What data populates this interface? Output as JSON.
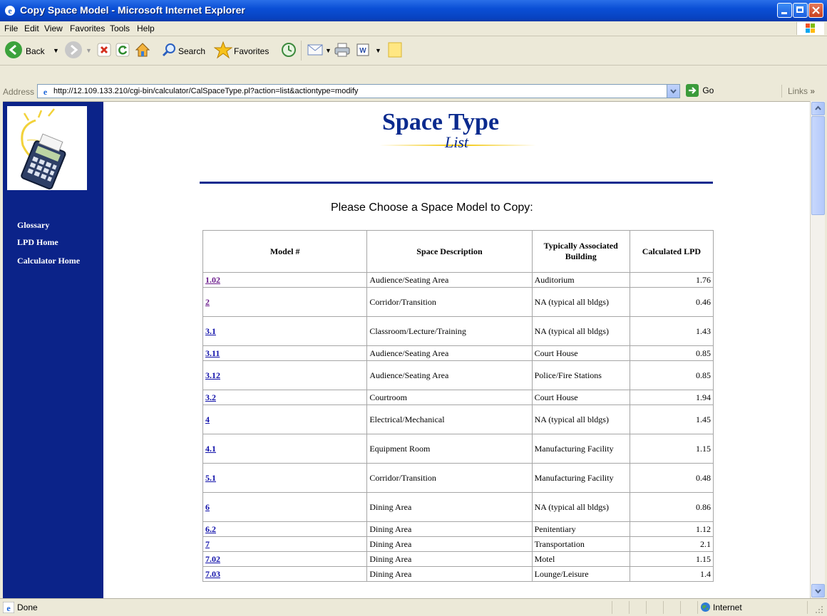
{
  "window": {
    "title": "Copy Space Model - Microsoft Internet Explorer"
  },
  "menu": [
    "File",
    "Edit",
    "View",
    "Favorites",
    "Tools",
    "Help"
  ],
  "toolbar": {
    "back": "Back",
    "search": "Search",
    "favorites": "Favorites"
  },
  "address": {
    "label": "Address",
    "url": "http://12.109.133.210/cgi-bin/calculator/CalSpaceType.pl?action=list&actiontype=modify",
    "go": "Go",
    "links": "Links"
  },
  "sidebar": {
    "links": [
      "Glossary",
      "LPD Home",
      "Calculator Home"
    ]
  },
  "page": {
    "heading_main": "Space Type",
    "heading_sub": "List",
    "prompt": "Please Choose a Space Model to Copy:"
  },
  "table": {
    "headers": [
      "Model #",
      "Space Description",
      "Typically Associated Building",
      "Calculated LPD"
    ],
    "rows": [
      {
        "model": "1.02",
        "desc": "Audience/Seating Area",
        "bldg": "Auditorium",
        "lpd": "1.76"
      },
      {
        "model": "2",
        "desc": "Corridor/Transition",
        "bldg": "NA (typical all bldgs)",
        "lpd": "0.46"
      },
      {
        "model": "3.1",
        "desc": "Classroom/Lecture/Training",
        "bldg": "NA (typical all bldgs)",
        "lpd": "1.43"
      },
      {
        "model": "3.11",
        "desc": "Audience/Seating Area",
        "bldg": "Court House",
        "lpd": "0.85"
      },
      {
        "model": "3.12",
        "desc": "Audience/Seating Area",
        "bldg": "Police/Fire Stations",
        "lpd": "0.85"
      },
      {
        "model": "3.2",
        "desc": "Courtroom",
        "bldg": "Court House",
        "lpd": "1.94"
      },
      {
        "model": "4",
        "desc": "Electrical/Mechanical",
        "bldg": "NA (typical all bldgs)",
        "lpd": "1.45"
      },
      {
        "model": "4.1",
        "desc": "Equipment Room",
        "bldg": "Manufacturing Facility",
        "lpd": "1.15"
      },
      {
        "model": "5.1",
        "desc": "Corridor/Transition",
        "bldg": "Manufacturing Facility",
        "lpd": "0.48"
      },
      {
        "model": "6",
        "desc": "Dining Area",
        "bldg": "NA (typical all bldgs)",
        "lpd": "0.86"
      },
      {
        "model": "6.2",
        "desc": "Dining Area",
        "bldg": "Penitentiary",
        "lpd": "1.12"
      },
      {
        "model": "7",
        "desc": "Dining Area",
        "bldg": "Transportation",
        "lpd": "2.1"
      },
      {
        "model": "7.02",
        "desc": "Dining Area",
        "bldg": "Motel",
        "lpd": "1.15"
      },
      {
        "model": "7.03",
        "desc": "Dining Area",
        "bldg": "Lounge/Leisure",
        "lpd": "1.4"
      }
    ]
  },
  "status": {
    "left": "Done",
    "zone": "Internet"
  }
}
